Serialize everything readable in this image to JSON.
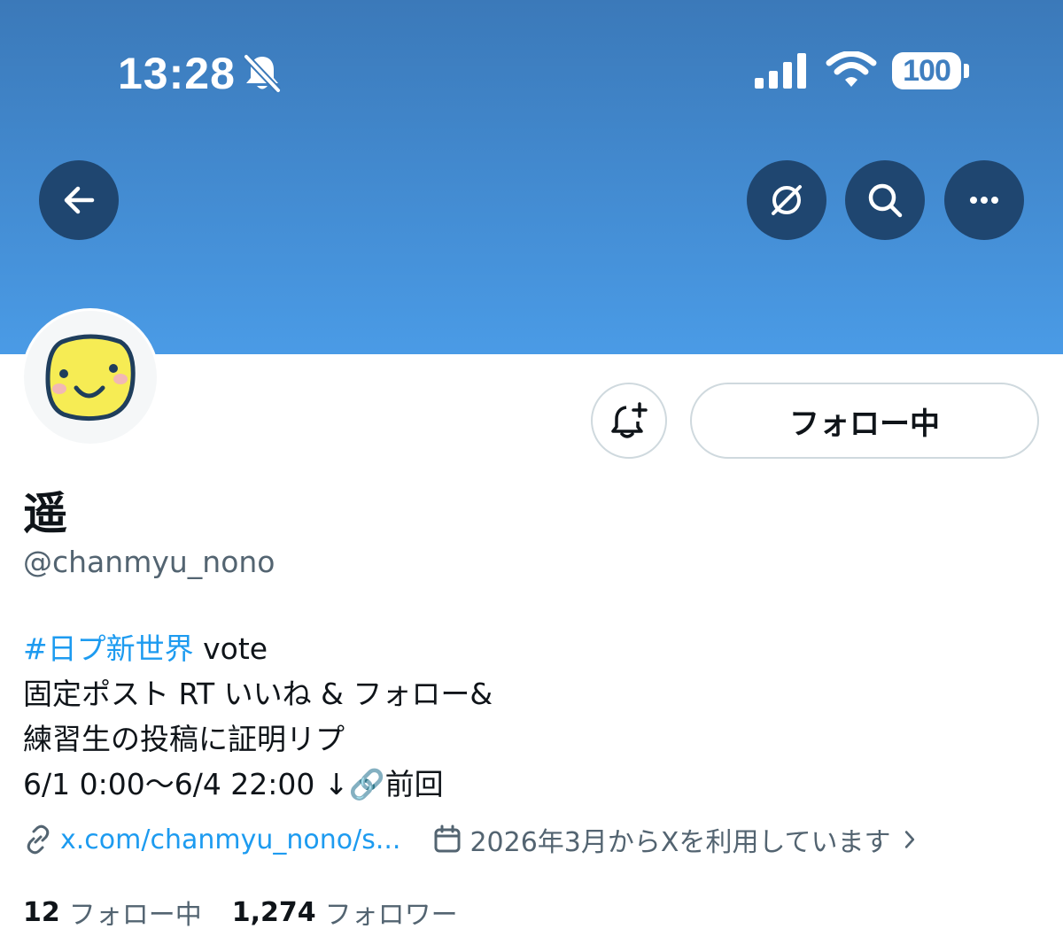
{
  "status_bar": {
    "time": "13:28",
    "battery": "100",
    "icons": [
      "bell-slash-icon",
      "cellular-signal-icon",
      "wifi-icon",
      "battery-icon"
    ]
  },
  "header": {
    "back_icon": "arrow-left-icon",
    "right_icons": [
      "translate-globe-slash-icon",
      "search-icon",
      "more-dots-icon"
    ]
  },
  "colors": {
    "banner_top": "#3b79b9",
    "banner_bottom": "#4a9be6",
    "nav_button": "#1f4670",
    "accent": "#1d9bf0",
    "secondary_text": "#536471"
  },
  "profile": {
    "name": "遥",
    "handle": "@chanmyu_nono",
    "avatar_icon": "yellow-smiley-face-avatar",
    "follow_button": "フォロー中",
    "bell_icon": "bell-plus-icon"
  },
  "bio": {
    "hashtag": "#日プ新世界",
    "line1_rest": " vote",
    "line2": "固定ポスト RT いいね & フォロー&",
    "line3": "練習生の投稿に証明リプ",
    "line4": "6/1 0:00～6/4 22:00 ↓🔗前回"
  },
  "meta": {
    "link_icon": "link-icon",
    "link": "x.com/chanmyu_nono/s...",
    "calendar_icon": "calendar-icon",
    "joined": "2026年3月からXを利用しています",
    "chevron_icon": "chevron-right-icon"
  },
  "stats": {
    "following_count": "12",
    "following_label": "フォロー中",
    "followers_count": "1,274",
    "followers_label": "フォロワー"
  }
}
